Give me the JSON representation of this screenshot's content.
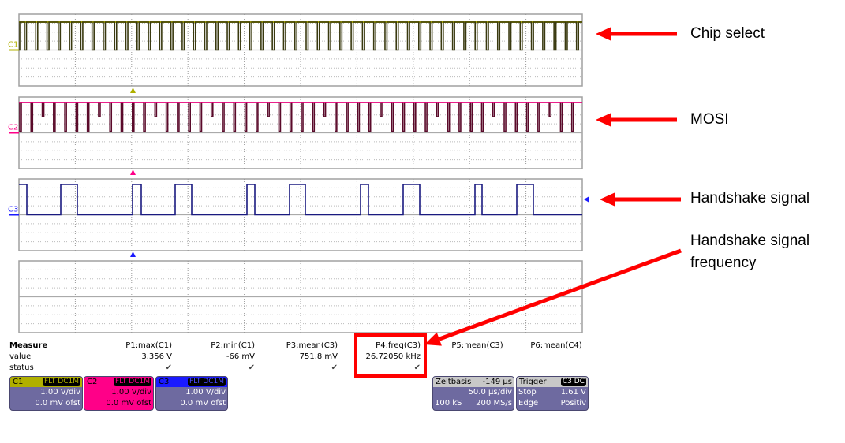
{
  "channels": [
    {
      "id": "C1",
      "color": "#b0b000",
      "trace": "#3a3a10",
      "coupling1": "FLT",
      "coupling2": "DC1M",
      "vdiv": "1.00 V/div",
      "offset": "0.0 mV ofst"
    },
    {
      "id": "C2",
      "color": "#ff0088",
      "trace": "#5a0a2a",
      "coupling1": "FLT",
      "coupling2": "DC1M",
      "vdiv": "1.00 V/div",
      "offset": "0.0 mV ofst"
    },
    {
      "id": "C3",
      "color": "#1a1aff",
      "trace": "#1a1a80",
      "coupling1": "FLT",
      "coupling2": "DC1M",
      "vdiv": "1.00 V/div",
      "offset": "0.0 mV ofst"
    }
  ],
  "measure": {
    "title": "Measure",
    "row_value": "value",
    "row_status": "status",
    "params": [
      {
        "name": "P1:max(C1)",
        "value": "3.356 V",
        "status": "✔"
      },
      {
        "name": "P2:min(C1)",
        "value": "-66 mV",
        "status": "✔"
      },
      {
        "name": "P3:mean(C3)",
        "value": "751.8 mV",
        "status": "✔"
      },
      {
        "name": "P4:freq(C3)",
        "value": "26.72050 kHz",
        "status": "✔"
      },
      {
        "name": "P5:mean(C3)",
        "value": "",
        "status": ""
      },
      {
        "name": "P6:mean(C4)",
        "value": "",
        "status": ""
      }
    ]
  },
  "timebase": {
    "label": "Zeitbasis",
    "delay": "-149 µs",
    "tdiv": "50.0 µs/div",
    "samples": "100 kS",
    "rate": "200 MS/s"
  },
  "trigger": {
    "label": "Trigger",
    "source": "C3",
    "coupling": "DC",
    "mode": "Stop",
    "level": "1.61 V",
    "type": "Edge",
    "slope": "Positiv"
  },
  "annotations": {
    "chip_select": "Chip select",
    "mosi": "MOSI",
    "handshake": "Handshake signal",
    "freq_line1": "Handshake signal",
    "freq_line2": "frequency"
  },
  "colors": {
    "annotation_red": "#ff0000",
    "panel_border": "#a0a0a0",
    "box_bg": "#6e6aa0"
  }
}
